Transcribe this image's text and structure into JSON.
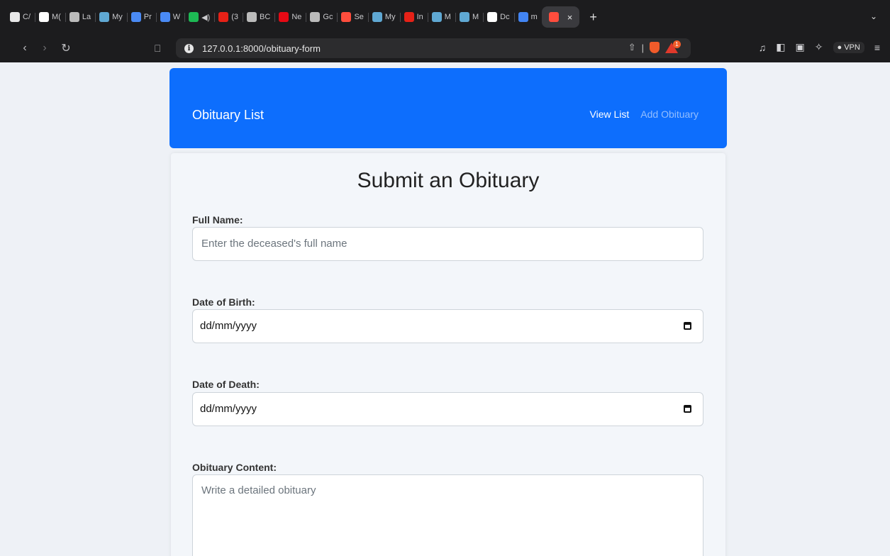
{
  "browser": {
    "tabs": [
      {
        "label": "C/",
        "color": "#e8e8e8"
      },
      {
        "label": "M(",
        "color": "#ffffff"
      },
      {
        "label": "La",
        "color": "#bbbbbb"
      },
      {
        "label": "My",
        "color": "#5fa8d3"
      },
      {
        "label": "Pr",
        "color": "#4a8af4"
      },
      {
        "label": "W",
        "color": "#4a8af4"
      },
      {
        "label": "◀)",
        "color": "#1db954"
      },
      {
        "label": "(3",
        "color": "#e62117"
      },
      {
        "label": "BC",
        "color": "#bbbbbb"
      },
      {
        "label": "Ne",
        "color": "#e50914"
      },
      {
        "label": "Gc",
        "color": "#bbbbbb"
      },
      {
        "label": "Se",
        "color": "#ff4d3d"
      },
      {
        "label": "My",
        "color": "#5fa8d3"
      },
      {
        "label": "In",
        "color": "#e62117"
      },
      {
        "label": "M",
        "color": "#5fa8d3"
      },
      {
        "label": "M",
        "color": "#5fa8d3"
      },
      {
        "label": "Dc",
        "color": "#ffffff"
      },
      {
        "label": "m",
        "color": "#4285f4"
      }
    ],
    "active_tab_close": "×",
    "new_tab": "+",
    "tab_menu": "⌄",
    "url": "127.0.0.1:8000/obituary-form",
    "vpn_label": "VPN",
    "rewards_badge": "1"
  },
  "navbar": {
    "brand": "Obituary List",
    "links": {
      "view": "View List",
      "add": "Add Obituary"
    }
  },
  "form": {
    "title": "Submit an Obituary",
    "full_name": {
      "label": "Full Name:",
      "placeholder": "Enter the deceased's full name"
    },
    "dob": {
      "label": "Date of Birth:",
      "value": "dd/mm/yyyy"
    },
    "dod": {
      "label": "Date of Death:",
      "value": "dd/mm/yyyy"
    },
    "content": {
      "label": "Obituary Content:",
      "placeholder": "Write a detailed obituary"
    }
  },
  "colors": {
    "primary": "#0d6efd",
    "background": "#eef1f6"
  }
}
